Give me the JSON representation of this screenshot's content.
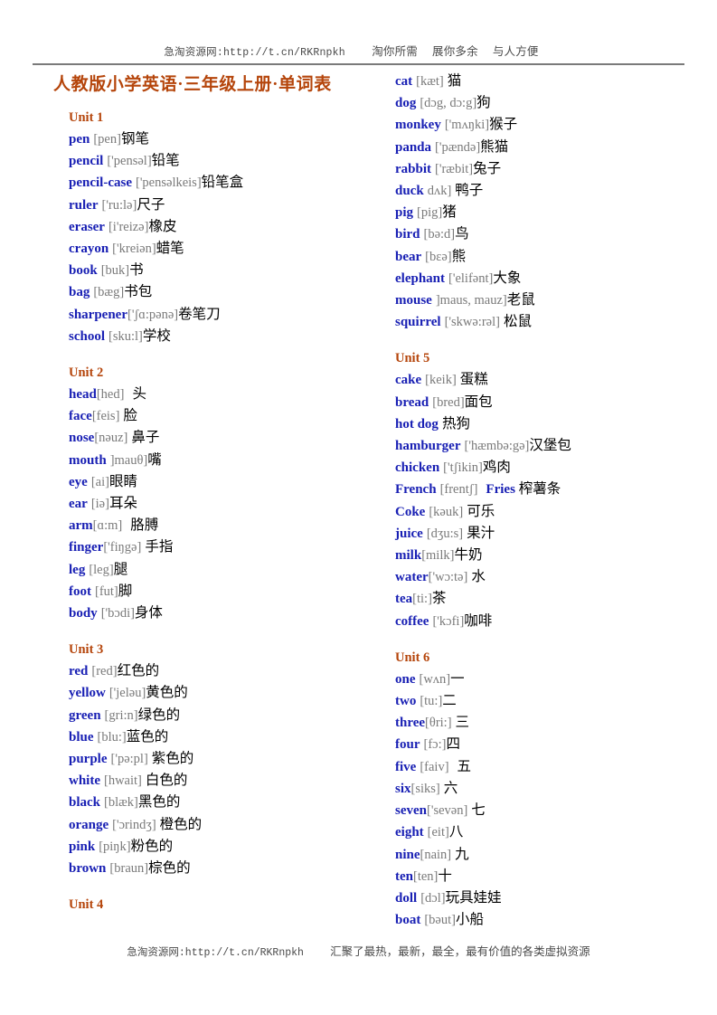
{
  "header": {
    "site_text": "急淘资源网:http://t.cn/RKRnpkh",
    "slogans": [
      "淘你所需",
      "展你多余",
      "与人方便"
    ]
  },
  "title": "人教版小学英语·三年级上册·单词表",
  "colors": {
    "title": "#B5450B",
    "unit_heading": "#B5450B",
    "word": "#1920B4",
    "phonetic": "#7a7a7a",
    "meaning": "#000000"
  },
  "footer": {
    "site_text": "急淘资源网:http://t.cn/RKRnpkh",
    "slogan": "汇聚了最热，最新，最全，最有价值的各类虚拟资源"
  },
  "columns": [
    {
      "name": "left-column",
      "units": [
        {
          "heading": "Unit 1",
          "entries": [
            {
              "word": "pen",
              "gap": " ",
              "phonetic": "[pen]",
              "tail": "",
              "meaning": "钢笔"
            },
            {
              "word": "pencil",
              "gap": " ",
              "phonetic": "['pensəl]",
              "tail": "",
              "meaning": "铅笔"
            },
            {
              "word": "pencil-case",
              "gap": " ",
              "phonetic": "['pensəlkeis]",
              "tail": "",
              "meaning": "铅笔盒"
            },
            {
              "word": "ruler",
              "gap": " ",
              "phonetic": "['ru:lə]",
              "tail": "",
              "meaning": "尺子"
            },
            {
              "word": "eraser",
              "gap": " ",
              "phonetic": "[i'reizə]",
              "tail": "",
              "meaning": "橡皮"
            },
            {
              "word": "crayon",
              "gap": " ",
              "phonetic": "['kreiən]",
              "tail": "",
              "meaning": "蜡笔"
            },
            {
              "word": "book",
              "gap": " ",
              "phonetic": "[buk]",
              "tail": "",
              "meaning": "书"
            },
            {
              "word": "bag",
              "gap": " ",
              "phonetic": "[bæg]",
              "tail": "",
              "meaning": "书包"
            },
            {
              "word": "sharpener",
              "gap": "",
              "phonetic": "['ʃɑ:pənə]",
              "tail": "",
              "meaning": "卷笔刀"
            },
            {
              "word": "school",
              "gap": " ",
              "phonetic": "[sku:l]",
              "tail": "",
              "meaning": "学校"
            }
          ]
        },
        {
          "heading": "Unit 2",
          "entries": [
            {
              "word": "head",
              "gap": "",
              "phonetic": "[hed]",
              "tail": "  ",
              "meaning": "头"
            },
            {
              "word": "face",
              "gap": "",
              "phonetic": "[feis]",
              "tail": " ",
              "meaning": "脸"
            },
            {
              "word": "nose",
              "gap": "",
              "phonetic": "[nəuz]",
              "tail": " ",
              "meaning": "鼻子"
            },
            {
              "word": "mouth",
              "gap": " ",
              "phonetic": "]mauθ]",
              "tail": "",
              "meaning": "嘴"
            },
            {
              "word": "eye",
              "gap": " ",
              "phonetic": "[ai]",
              "tail": "",
              "meaning": "眼睛"
            },
            {
              "word": "ear",
              "gap": " ",
              "phonetic": "[iə]",
              "tail": "",
              "meaning": "耳朵"
            },
            {
              "word": "arm",
              "gap": "",
              "phonetic": "[ɑ:m]",
              "tail": "  ",
              "meaning": "胳膊"
            },
            {
              "word": "finger",
              "gap": "",
              "phonetic": "['fiŋgə]",
              "tail": " ",
              "meaning": "手指"
            },
            {
              "word": "leg",
              "gap": " ",
              "phonetic": "[leg]",
              "tail": "",
              "meaning": "腿"
            },
            {
              "word": "foot",
              "gap": " ",
              "phonetic": "[fut]",
              "tail": "",
              "meaning": "脚"
            },
            {
              "word": "body",
              "gap": " ",
              "phonetic": "['bɔdi]",
              "tail": "",
              "meaning": "身体"
            }
          ]
        },
        {
          "heading": "Unit 3",
          "entries": [
            {
              "word": "red",
              "gap": " ",
              "phonetic": "[red]",
              "tail": "",
              "meaning": "红色的"
            },
            {
              "word": "yellow",
              "gap": " ",
              "phonetic": "['jeləu]",
              "tail": "",
              "meaning": "黄色的"
            },
            {
              "word": "green",
              "gap": " ",
              "phonetic": "[gri:n]",
              "tail": "",
              "meaning": "绿色的"
            },
            {
              "word": "blue",
              "gap": " ",
              "phonetic": "[blu:]",
              "tail": "",
              "meaning": "蓝色的"
            },
            {
              "word": "purple",
              "gap": " ",
              "phonetic": "['pə:pl]",
              "tail": " ",
              "meaning": "紫色的"
            },
            {
              "word": "white",
              "gap": " ",
              "phonetic": "[hwait]",
              "tail": " ",
              "meaning": "白色的"
            },
            {
              "word": "black",
              "gap": " ",
              "phonetic": "[blæk]",
              "tail": "",
              "meaning": "黑色的"
            },
            {
              "word": "orange",
              "gap": " ",
              "phonetic": "['ɔrindʒ]",
              "tail": " ",
              "meaning": "橙色的"
            },
            {
              "word": "pink",
              "gap": " ",
              "phonetic": "[piŋk]",
              "tail": "",
              "meaning": "粉色的"
            },
            {
              "word": "brown",
              "gap": " ",
              "phonetic": "[braun]",
              "tail": "",
              "meaning": "棕色的"
            }
          ]
        },
        {
          "heading": "Unit 4",
          "entries": []
        }
      ]
    },
    {
      "name": "right-column",
      "units": [
        {
          "heading": "",
          "entries": [
            {
              "word": "cat",
              "gap": " ",
              "phonetic": "[kæt]",
              "tail": " ",
              "meaning": "猫"
            },
            {
              "word": "dog",
              "gap": " ",
              "phonetic": "[dɔg, dɔ:g]",
              "tail": "",
              "meaning": "狗"
            },
            {
              "word": "monkey",
              "gap": " ",
              "phonetic": "['mʌŋki]",
              "tail": "",
              "meaning": "猴子"
            },
            {
              "word": "panda",
              "gap": " ",
              "phonetic": "['pændə]",
              "tail": "",
              "meaning": "熊猫"
            },
            {
              "word": "rabbit",
              "gap": " ",
              "phonetic": "['ræbit]",
              "tail": "",
              "meaning": "兔子"
            },
            {
              "word": "duck",
              "gap": " ",
              "phonetic": "dʌk]",
              "tail": " ",
              "meaning": "鸭子"
            },
            {
              "word": "pig",
              "gap": " ",
              "phonetic": "[pig]",
              "tail": "",
              "meaning": "猪"
            },
            {
              "word": "bird",
              "gap": " ",
              "phonetic": "[bə:d]",
              "tail": "",
              "meaning": "鸟"
            },
            {
              "word": "bear",
              "gap": " ",
              "phonetic": "[bɛə]",
              "tail": "",
              "meaning": "熊"
            },
            {
              "word": "elephant",
              "gap": " ",
              "phonetic": "['elifənt]",
              "tail": "",
              "meaning": "大象"
            },
            {
              "word": "mouse",
              "gap": " ",
              "phonetic": "]maus, mauz]",
              "tail": "",
              "meaning": "老鼠"
            },
            {
              "word": "squirrel",
              "gap": " ",
              "phonetic": "['skwə:rəl]",
              "tail": " ",
              "meaning": "松鼠"
            }
          ]
        },
        {
          "heading": "Unit 5",
          "entries": [
            {
              "word": "cake",
              "gap": " ",
              "phonetic": "[keik]",
              "tail": " ",
              "meaning": "蛋糕"
            },
            {
              "word": "bread",
              "gap": " ",
              "phonetic": "[bred]",
              "tail": "",
              "meaning": "面包"
            },
            {
              "word": "hot dog",
              "gap": " ",
              "phonetic": "",
              "tail": "",
              "meaning": "热狗"
            },
            {
              "word": "hamburger",
              "gap": " ",
              "phonetic": "['hæmbə:gə]",
              "tail": "",
              "meaning": "汉堡包"
            },
            {
              "word": "chicken",
              "gap": " ",
              "phonetic": "['tʃikin]",
              "tail": "",
              "meaning": "鸡肉"
            },
            {
              "word": "French",
              "gap": " ",
              "phonetic": "[frentʃ]",
              "tail": "   ",
              "word2": "Fries",
              "meaning": " 榨薯条"
            },
            {
              "word": "Coke",
              "gap": " ",
              "phonetic": "[kəuk]",
              "tail": " ",
              "meaning": "可乐"
            },
            {
              "word": "juice",
              "gap": " ",
              "phonetic": "[dʒu:s]",
              "tail": " ",
              "meaning": "果汁"
            },
            {
              "word": "milk",
              "gap": "",
              "phonetic": "[milk]",
              "tail": "",
              "meaning": "牛奶"
            },
            {
              "word": "water",
              "gap": "",
              "phonetic": "['wɔ:tə]",
              "tail": " ",
              "meaning": "水"
            },
            {
              "word": "tea",
              "gap": "",
              "phonetic": "[ti:]",
              "tail": "",
              "meaning": "茶"
            },
            {
              "word": "coffee",
              "gap": " ",
              "phonetic": "['kɔfi]",
              "tail": "",
              "meaning": "咖啡"
            }
          ]
        },
        {
          "heading": "Unit 6",
          "entries": [
            {
              "word": "one",
              "gap": " ",
              "phonetic": "[wʌn]",
              "tail": "",
              "meaning": "一"
            },
            {
              "word": "two",
              "gap": " ",
              "phonetic": "[tu:]",
              "tail": "",
              "meaning": "二"
            },
            {
              "word": "three",
              "gap": "",
              "phonetic": "[θri:]",
              "tail": " ",
              "meaning": "三"
            },
            {
              "word": "four",
              "gap": " ",
              "phonetic": "[fɔ:]",
              "tail": "",
              "meaning": "四"
            },
            {
              "word": "five",
              "gap": " ",
              "phonetic": "[faiv]",
              "tail": "  ",
              "meaning": "五"
            },
            {
              "word": "six",
              "gap": "",
              "phonetic": "[siks]",
              "tail": " ",
              "meaning": "六"
            },
            {
              "word": "seven",
              "gap": "",
              "phonetic": "['sevən]",
              "tail": " ",
              "meaning": "七"
            },
            {
              "word": "eight",
              "gap": " ",
              "phonetic": "[eit]",
              "tail": "",
              "meaning": "八"
            },
            {
              "word": "nine",
              "gap": "",
              "phonetic": "[nain]",
              "tail": " ",
              "meaning": "九"
            },
            {
              "word": "ten",
              "gap": "",
              "phonetic": "[ten]",
              "tail": "",
              "meaning": "十"
            },
            {
              "word": "doll",
              "gap": " ",
              "phonetic": "[dɔl]",
              "tail": "",
              "meaning": "玩具娃娃"
            },
            {
              "word": "boat",
              "gap": " ",
              "phonetic": "[bəut]",
              "tail": "",
              "meaning": "小船"
            }
          ]
        }
      ]
    }
  ]
}
